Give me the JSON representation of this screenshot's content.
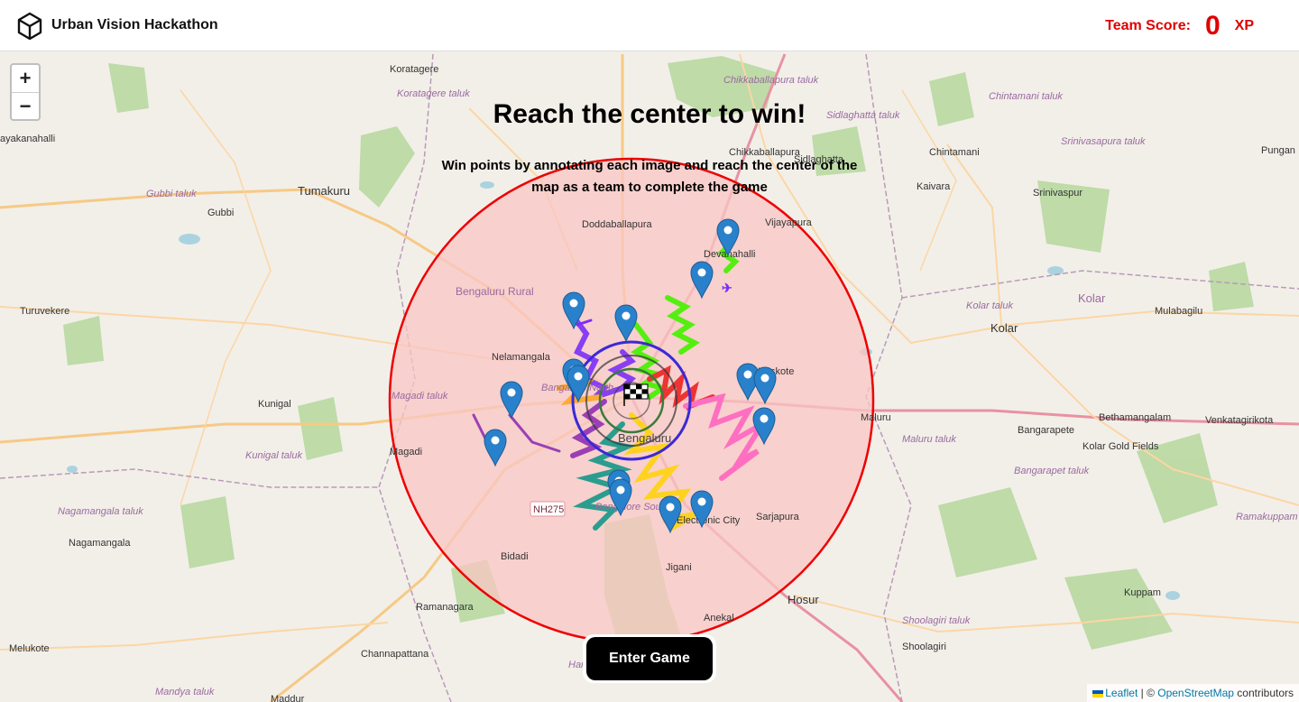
{
  "header": {
    "title": "Urban Vision Hackathon",
    "score_label": "Team Score:",
    "score_value": "0",
    "score_unit": "XP"
  },
  "zoom": {
    "in_label": "+",
    "out_label": "−"
  },
  "hero": {
    "headline": "Reach the center to win!",
    "subtitle": "Win points by annotating each image and reach the center of the map as a team to complete the game"
  },
  "cta": {
    "label": "Enter Game"
  },
  "attribution": {
    "leaflet": "Leaflet",
    "separator": " | © ",
    "osm": "OpenStreetMap",
    "suffix": " contributors"
  },
  "map_labels": {
    "koratagere": "Koratagere",
    "koratagere_taluk": "Koratagere taluk",
    "chikkaballapura": "Chikkaballapura",
    "chikkaballapura_taluk": "Chikkaballapura taluk",
    "sidlaghatta": "Sidlaghatta",
    "sidlaghatta_taluk": "Sidlaghatta taluk",
    "chintamani": "Chintamani",
    "chintamani_taluk": "Chintamani taluk",
    "srinivasapura_taluk": "Srinivasapura taluk",
    "pungan": "Pungan",
    "ayakanahalli": "ayakanahalli",
    "gubbi_taluk": "Gubbi taluk",
    "tumakuru": "Tumakuru",
    "gubbi": "Gubbi",
    "doddaballapura": "Doddaballapura",
    "vijayapura": "Vijayapura",
    "kaivara": "Kaivara",
    "srinivaspur": "Srinivaspur",
    "devanahalli": "Devanahalli",
    "kolar_region": "Kolar",
    "kolar_taluk": "Kolar taluk",
    "kolar": "Kolar",
    "mulabagilu": "Mulabagilu",
    "turuvekere": "Turuvekere",
    "bengaluru_rural": "Bengaluru Rural",
    "nelamangala": "Nelamangala",
    "hoskote": "Hoskote",
    "kunigal": "Kunigal",
    "magadi_taluk": "Magadi taluk",
    "bangalore_north": "Bangalore North",
    "bengaluru": "Bengaluru",
    "maluru": "Maluru",
    "maluru_taluk": "Maluru taluk",
    "bethamangalam": "Bethamangalam",
    "venkatagirikota": "Venkatagirikota",
    "bangarapete": "Bangarapete",
    "kolar_gold_fields": "Kolar Gold Fields",
    "bangarapet_taluk": "Bangarapet taluk",
    "magadi": "Magadi",
    "kunigal_taluk": "Kunigal taluk",
    "nagamangala_taluk": "Nagamangala taluk",
    "nagamangala": "Nagamangala",
    "bidadi": "Bidadi",
    "nh275": "NH275",
    "electronic_city": "Electronic City",
    "sarjapura": "Sarjapura",
    "jigani": "Jigani",
    "ramanagara": "Ramanagara",
    "hosur": "Hosur",
    "anekal": "Anekal",
    "shoolagiri_taluk": "Shoolagiri taluk",
    "shoolagiri": "Shoolagiri",
    "kuppam": "Kuppam",
    "ramakuppam": "Ramakuppam",
    "melukote": "Melukote",
    "channapattana": "Channapattana",
    "mandya_taluk": "Mandya taluk",
    "maddur": "Maddur",
    "bangalore_south": "Bangalore South",
    "hanur": "Han"
  },
  "colors": {
    "accent": "#e00000",
    "zone_fill": "#f9c5c3",
    "zone_stroke": "#ee0000",
    "marker": "#2a81cb"
  }
}
